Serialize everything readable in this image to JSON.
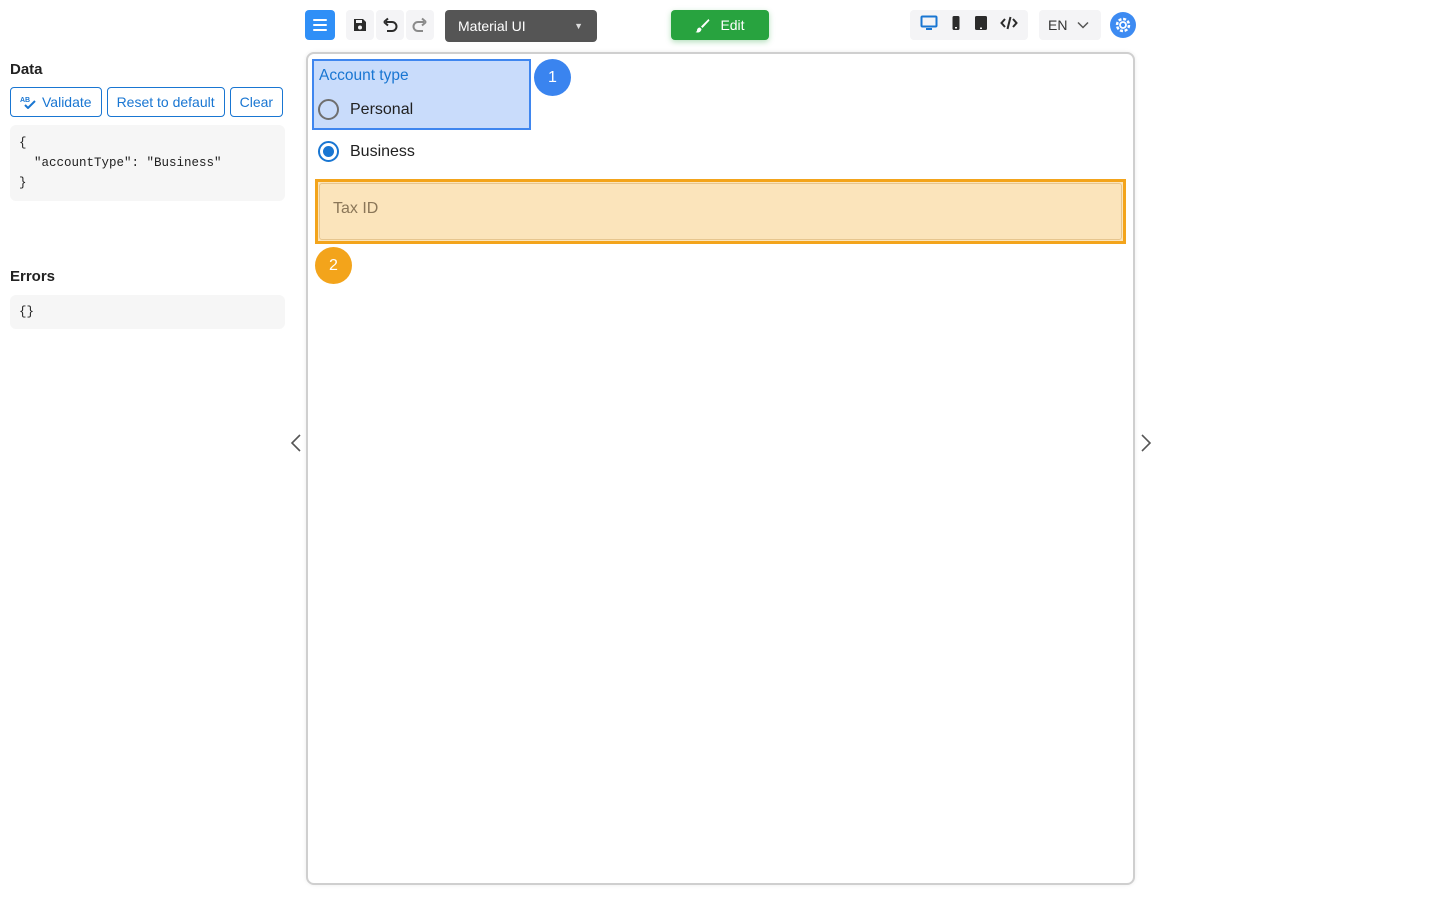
{
  "left_panel": {
    "data_title": "Data",
    "buttons": {
      "validate": "Validate",
      "reset": "Reset to default",
      "clear": "Clear"
    },
    "data_json": "{\n  \"accountType\": \"Business\"\n}",
    "errors_title": "Errors",
    "errors_json": "{}"
  },
  "toolbar": {
    "menu_icon": "hamburger-menu-icon",
    "save_icon": "save-icon",
    "undo_icon": "undo-icon",
    "redo_icon": "redo-icon",
    "theme_select": "Material UI",
    "edit_label": "Edit",
    "device_icons": [
      "desktop-icon",
      "mobile-icon",
      "tablet-icon",
      "code-icon"
    ],
    "language": "EN",
    "settings_icon": "gear-icon"
  },
  "form": {
    "group_label": "Account type",
    "options": [
      {
        "label": "Personal",
        "checked": false
      },
      {
        "label": "Business",
        "checked": true
      }
    ],
    "tax_id_placeholder": "Tax ID",
    "badges": [
      "1",
      "2"
    ]
  },
  "colors": {
    "accent": "#1976d2",
    "edit_green": "#28a33f",
    "highlight_blue": "#3f86ef",
    "highlight_orange": "#f3a41b"
  }
}
